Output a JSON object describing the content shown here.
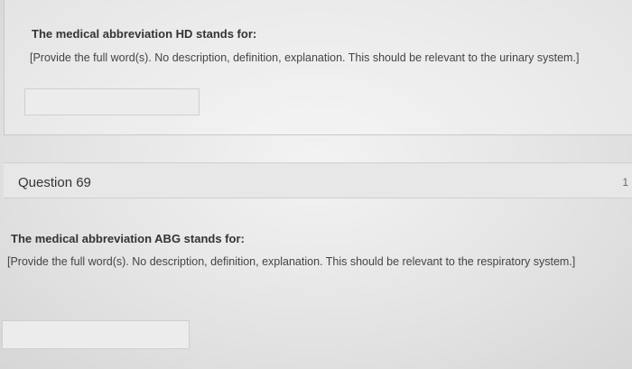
{
  "question_68": {
    "prompt": "The medical abbreviation HD stands for:",
    "instructions": "[Provide the full word(s). No description, definition, explanation. This should be relevant to the urinary system.]",
    "answer_value": ""
  },
  "question_69": {
    "title": "Question 69",
    "points": "1",
    "prompt": "The medical abbreviation ABG stands for:",
    "instructions": "[Provide the full word(s). No description, definition, explanation. This should be relevant to the respiratory system.]",
    "answer_value": ""
  }
}
